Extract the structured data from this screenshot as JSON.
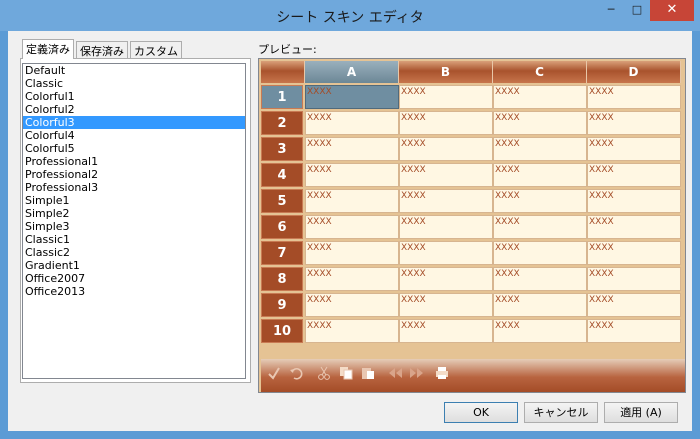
{
  "window": {
    "title": "シート スキン エディタ",
    "minimize_glyph": "─",
    "maximize_glyph": "□",
    "close_glyph": "✕"
  },
  "tabs": [
    {
      "label": "定義済み",
      "active": true
    },
    {
      "label": "保存済み",
      "active": false
    },
    {
      "label": "カスタム",
      "active": false
    }
  ],
  "skin_list": {
    "items": [
      "Default",
      "Classic",
      "Colorful1",
      "Colorful2",
      "Colorful3",
      "Colorful4",
      "Colorful5",
      "Professional1",
      "Professional2",
      "Professional3",
      "Simple1",
      "Simple2",
      "Simple3",
      "Classic1",
      "Classic2",
      "Gradient1",
      "Office2007",
      "Office2013"
    ],
    "selected": "Colorful3"
  },
  "preview": {
    "label": "プレビュー:",
    "columns": [
      "A",
      "B",
      "C",
      "D"
    ],
    "rows": [
      "1",
      "2",
      "3",
      "4",
      "5",
      "6",
      "7",
      "8",
      "9",
      "10"
    ],
    "cell_text": "XXXX",
    "selected_column": "A",
    "selected_row": "1"
  },
  "toolbar_icons": [
    "checkmark-icon",
    "undo-icon",
    "cut-icon",
    "copy-icon",
    "paste-icon",
    "back-icon",
    "forward-icon",
    "print-icon"
  ],
  "colors": {
    "accent_brown": "#a44c27",
    "cell_bg": "#fff7e3",
    "selection": "#3399ff",
    "selected_cell": "#6f8ea1"
  },
  "buttons": {
    "ok": "OK",
    "cancel": "キャンセル",
    "apply": "適用 (A)"
  }
}
